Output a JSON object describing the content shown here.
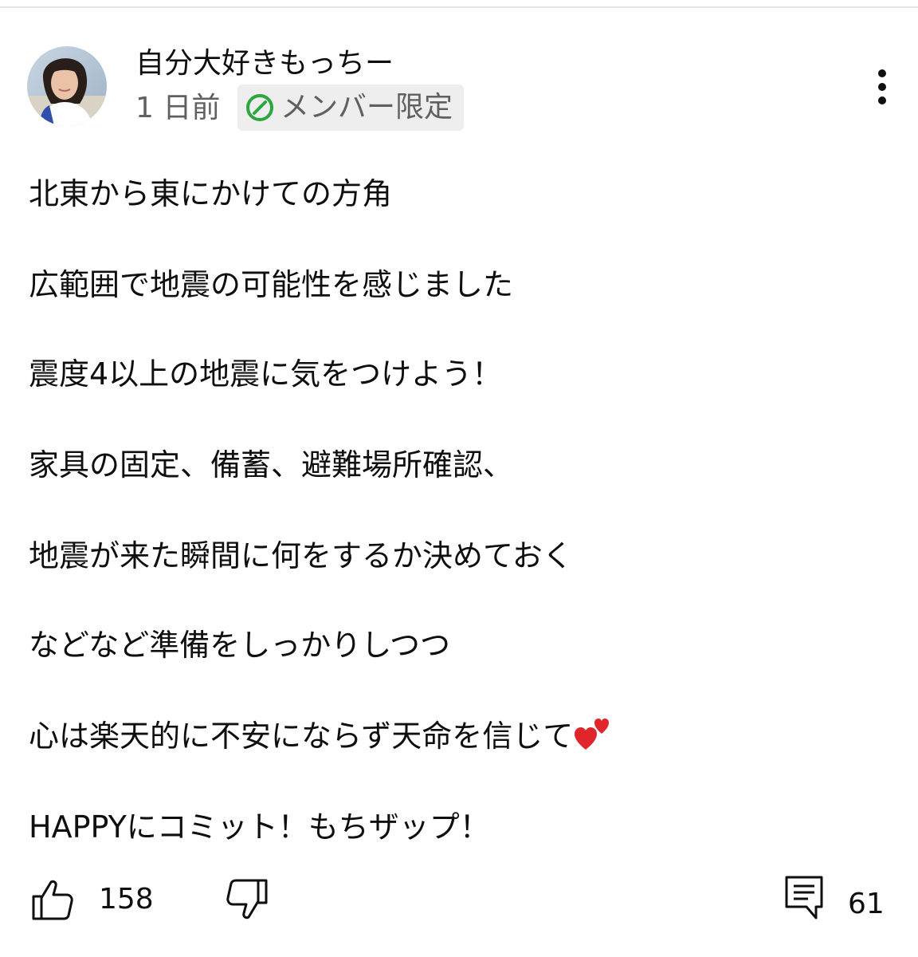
{
  "post": {
    "author": "自分大好きもっちー",
    "time": "1 日前",
    "badge_label": "メンバー限定",
    "lines": [
      "北東から東にかけての方角",
      "広範囲で地震の可能性を感じました",
      "震度4以上の地震に気をつけよう！",
      "家具の固定、備蓄、避難場所確認、",
      "地震が来た瞬間に何をするか決めておく",
      "などなど準備をしっかりしつつ",
      "心は楽天的に不安にならず天命を信じて",
      "HAPPYにコミット！もちザップ！"
    ],
    "last_line_emoji": "two-hearts-icon"
  },
  "actions": {
    "like_count": "158",
    "comment_count": "61"
  },
  "colors": {
    "text": "#0f0f0f",
    "secondary_text": "#606060",
    "badge_bg": "#eeeeee",
    "member_green": "#2ba640",
    "heart_red": "#e0262b"
  }
}
